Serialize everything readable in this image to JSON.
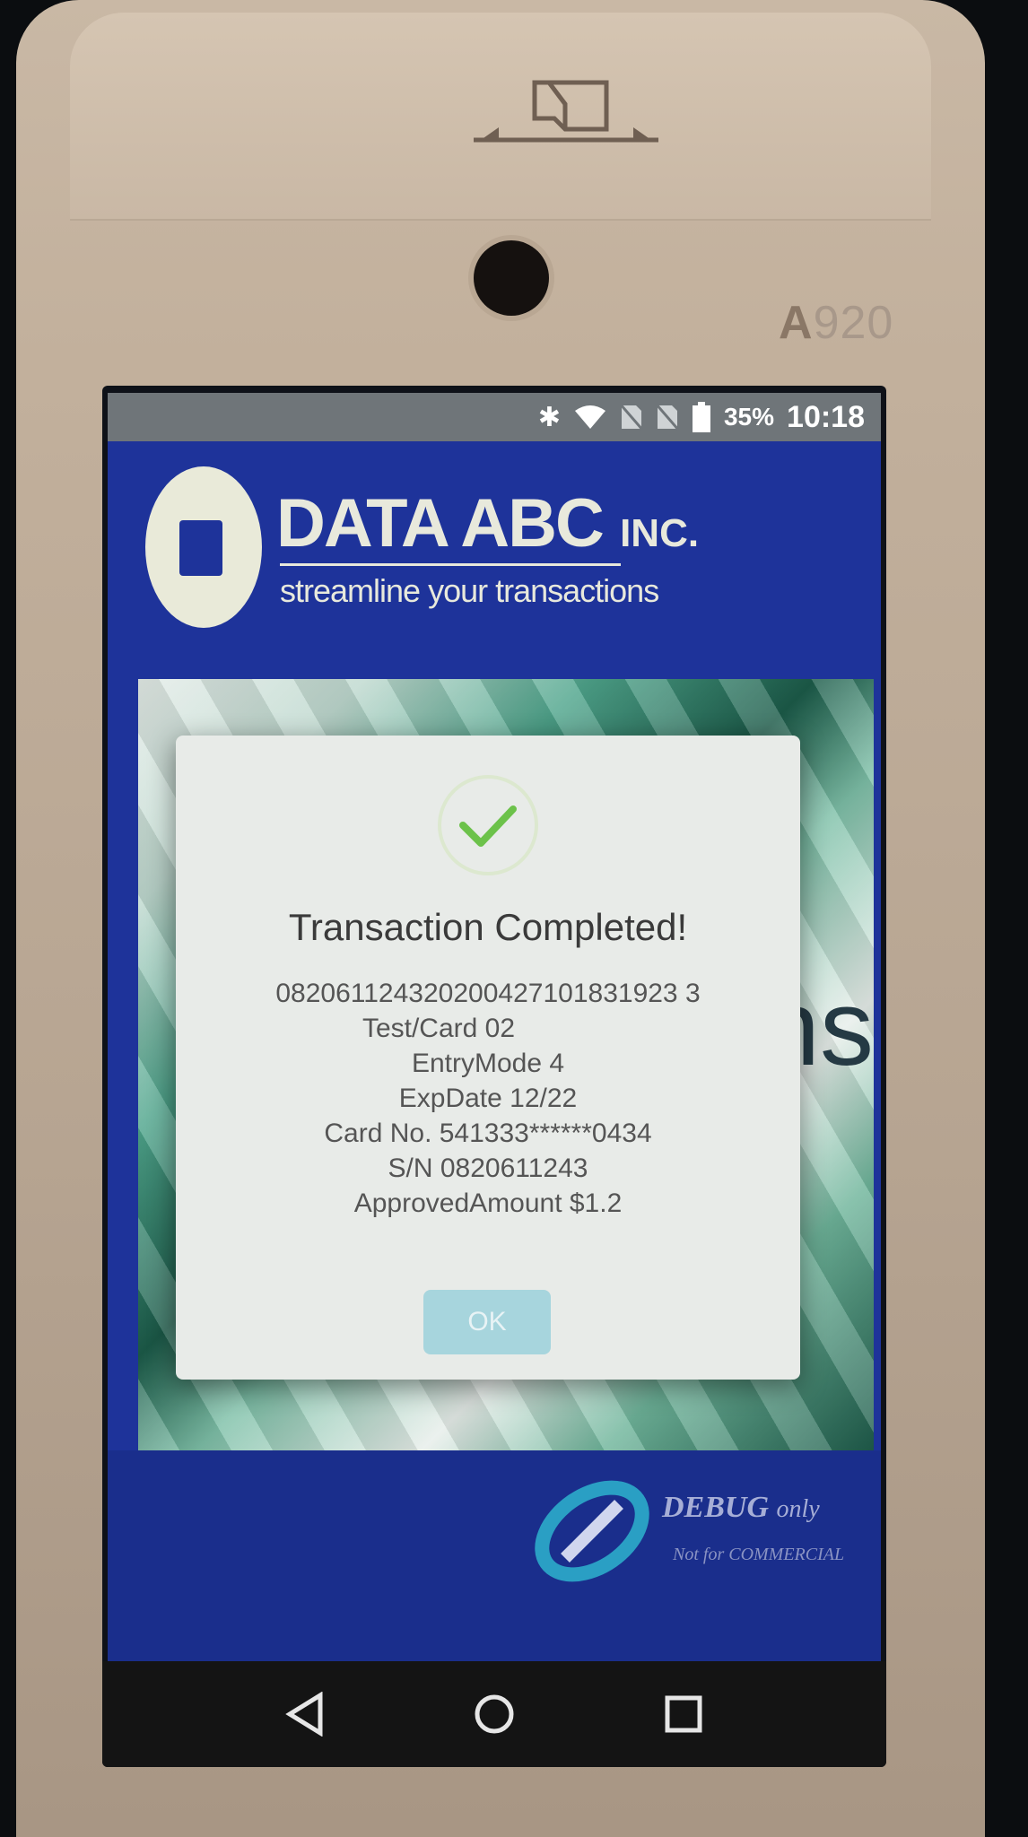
{
  "device": {
    "model_prefix": "A",
    "model_suffix": "920"
  },
  "status_bar": {
    "icons": [
      "bluetooth-icon",
      "wifi-icon",
      "no-sim-icon",
      "no-sim-icon",
      "battery-icon"
    ],
    "battery": "35%",
    "time": "10:18"
  },
  "header": {
    "brand": "DATA ABC",
    "brand_suffix": "INC.",
    "tagline": "streamline your transactions"
  },
  "banner": {
    "partial_text": "ns"
  },
  "dialog": {
    "title": "Transaction Completed!",
    "lines": [
      "082061124320200427101831923 3",
      "Test/Card 02",
      "EntryMode 4",
      "ExpDate 12/22",
      "Card No. 541333******0434",
      "S/N 0820611243",
      "ApprovedAmount $1.2"
    ],
    "ok_label": "OK"
  },
  "watermark": {
    "title": "DEBUG",
    "title_suffix": "only",
    "subtitle": "Not for COMMERCIAL"
  },
  "colors": {
    "brand_blue": "#1e339a",
    "dialog_bg": "#e8ebe8",
    "check_green": "#6cc24a",
    "ok_button": "#a7d5dd"
  }
}
